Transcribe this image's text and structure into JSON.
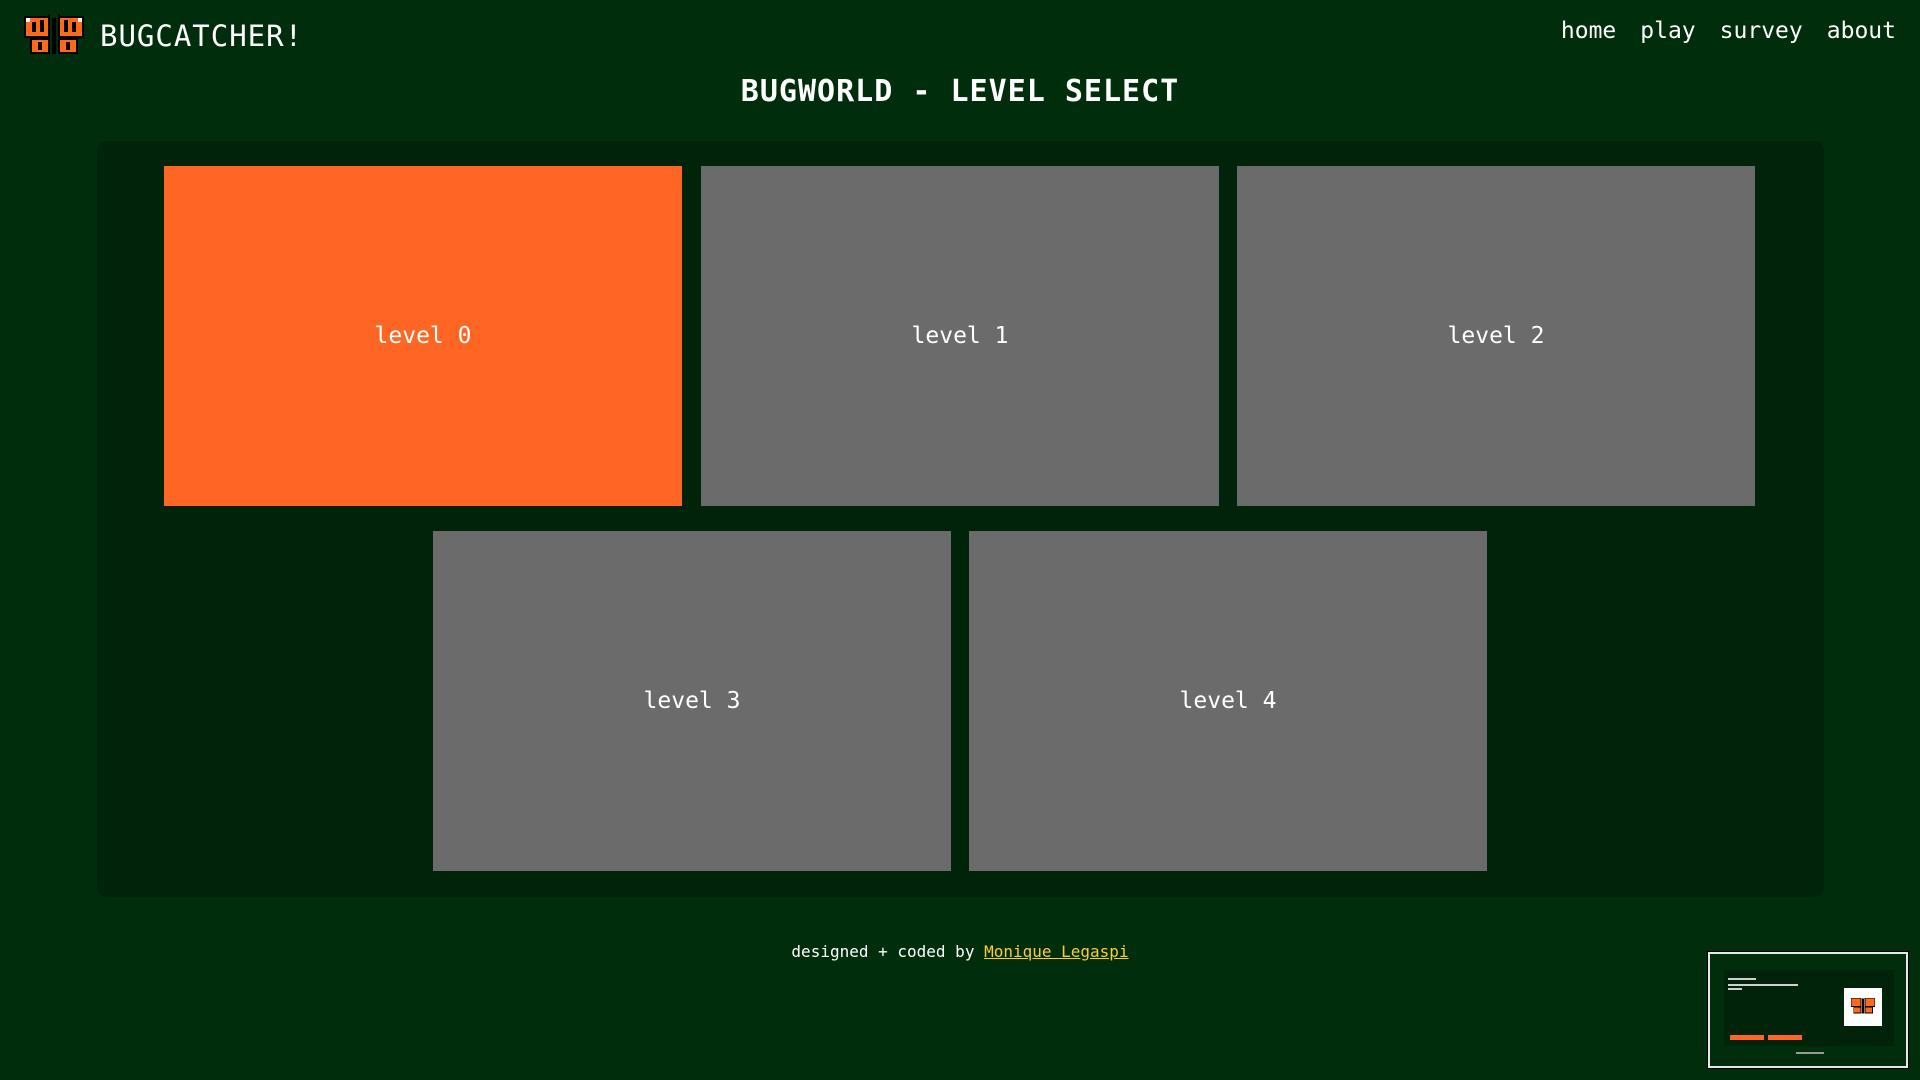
{
  "navbar": {
    "brand_title": "BUGCATCHER!",
    "links": [
      "home",
      "play",
      "survey",
      "about"
    ]
  },
  "page_title": "BUGWORLD - LEVEL SELECT",
  "levels": [
    {
      "label": "level 0",
      "state": "selected"
    },
    {
      "label": "level 1",
      "state": "default"
    },
    {
      "label": "level 2",
      "state": "default"
    },
    {
      "label": "level 3",
      "state": "default"
    },
    {
      "label": "level 4",
      "state": "default"
    }
  ],
  "footer": {
    "prefix": "designed + coded by ",
    "author_link": "Monique Legaspi"
  },
  "colors": {
    "background": "#002d0b",
    "panel": "#00230a",
    "accent_orange": "#ff6623",
    "card_gray": "#6b6b6b",
    "link_yellow": "#ffcb2e"
  },
  "icons": {
    "logo": "butterfly-icon"
  }
}
